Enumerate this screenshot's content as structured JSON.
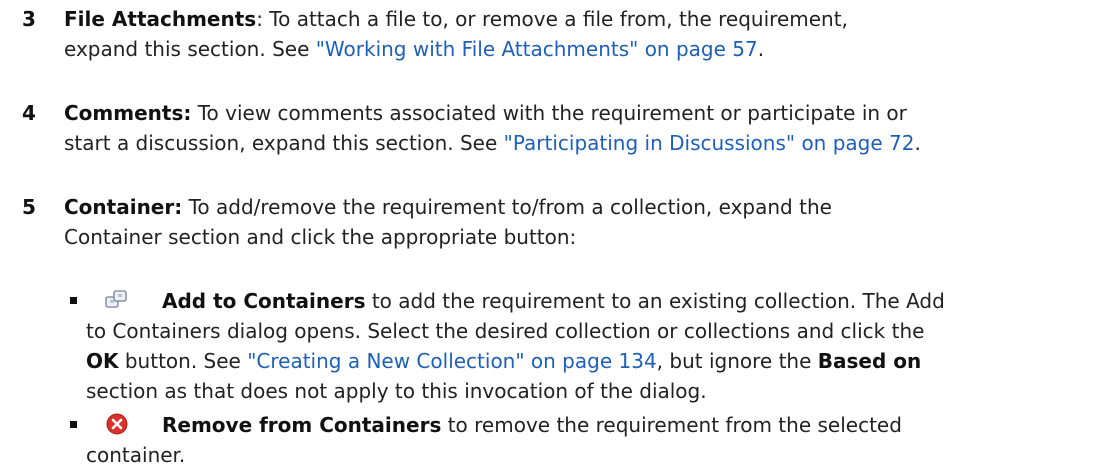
{
  "steps": [
    {
      "num": "3",
      "title": "File Attachments",
      "title_suffix": ": To attach a file to, or remove a file from, the requirement,",
      "line2_pre": "expand this section. See ",
      "link": "\"Working with File Attachments\" on page 57",
      "line2_post": "."
    },
    {
      "num": "4",
      "title": "Comments:",
      "line1_rest": " To view comments associated with the requirement or participate in or",
      "line2_pre": "start a discussion, expand this section. See ",
      "link": "\"Participating in Discussions\" on page 72",
      "line2_post": "."
    },
    {
      "num": "5",
      "title": "Container:",
      "line1_rest": " To add/remove the requirement to/from a collection, expand the",
      "line2": "Container section and click the appropriate button:"
    }
  ],
  "bullets": [
    {
      "icon": "add-to-containers-icon",
      "title": "Add to Containers",
      "l1_rest": " to add the requirement to an existing collection. The Add",
      "l2": "to Containers dialog opens. Select the desired collection or collections and click the",
      "l3_b": "OK",
      "l3_mid": " button. See ",
      "l3_link": "\"Creating a New Collection\" on page 134",
      "l3_post": ", but ignore the ",
      "l3_b2": "Based on",
      "l4": "section as that does not apply to this invocation of the dialog."
    },
    {
      "icon": "remove-from-containers-icon",
      "title": "Remove from Containers",
      "l1_rest": " to remove the requirement from the selected",
      "l2": "container."
    }
  ],
  "colors": {
    "link": "#1f5fb5",
    "remove_icon": "#d9322c"
  }
}
